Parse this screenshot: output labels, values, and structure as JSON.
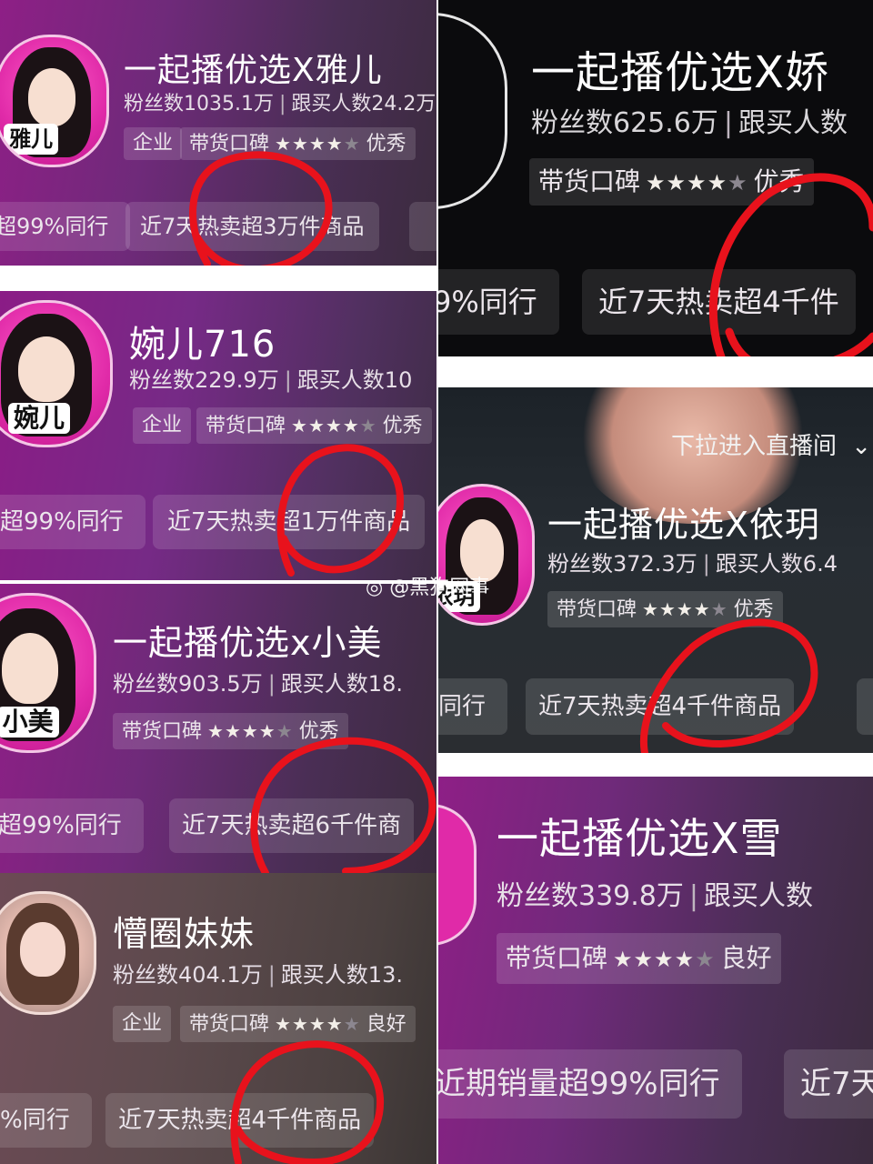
{
  "panels": {
    "p1": {
      "avatar_tag": "雅儿",
      "title": "一起播优选X雅儿",
      "fans": "粉丝数1035.1万",
      "buyers": "跟买人数24.2万",
      "chip_company": "企业",
      "chip_rating_label": "带货口碑",
      "rating_word": "优秀",
      "pill_left": "超99%同行",
      "pill_right": "近7天热卖超3万件商品"
    },
    "p2": {
      "avatar_tag": "婉儿",
      "title": "婉儿716",
      "fans": "粉丝数229.9万",
      "buyers": "跟买人数10",
      "chip_company": "企业",
      "chip_rating_label": "带货口碑",
      "rating_word": "优秀",
      "pill_left": "超99%同行",
      "pill_right": "近7天热卖超1万件商品"
    },
    "p3": {
      "avatar_tag": "小美",
      "title": "一起播优选x小美",
      "fans": "粉丝数903.5万",
      "buyers": "跟买人数18.",
      "chip_rating_label": "带货口碑",
      "rating_word": "优秀",
      "pill_left": "超99%同行",
      "pill_right": "近7天热卖超6千件商"
    },
    "p4": {
      "title": "懵圈妹妹",
      "fans": "粉丝数404.1万",
      "buyers": "跟买人数13.",
      "chip_company": "企业",
      "chip_rating_label": "带货口碑",
      "rating_word": "良好",
      "pill_left": "%同行",
      "pill_right": "近7天热卖超4千件商品"
    },
    "p5": {
      "title": "一起播优选X娇",
      "fans": "粉丝数625.6万",
      "buyers": "跟买人数",
      "chip_rating_label": "带货口碑",
      "rating_word": "优秀",
      "pill_left": "9%同行",
      "pill_right": "近7天热卖超4千件"
    },
    "p6": {
      "live_hint": "下拉进入直播间",
      "avatar_tag": "依玥",
      "title": "一起播优选X依玥",
      "fans": "粉丝数372.3万",
      "buyers": "跟买人数6.4",
      "chip_rating_label": "带货口碑",
      "rating_word": "优秀",
      "pill_left": "同行",
      "pill_right": "近7天热卖超4千件商品"
    },
    "p7": {
      "title": "一起播优选X雪",
      "fans": "粉丝数339.8万",
      "buyers": "跟买人数",
      "chip_rating_label": "带货口碑",
      "rating_word": "良好",
      "pill_left": "近期销量超99%同行",
      "pill_right": "近7天"
    }
  },
  "watermark": "@黑狗网事",
  "colors": {
    "annotation_red": "#e8121c",
    "accent_pink": "#e02aa8"
  }
}
